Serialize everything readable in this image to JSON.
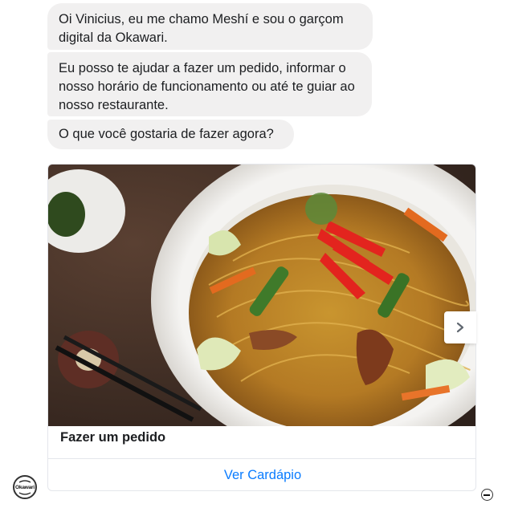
{
  "messages": [
    {
      "text": "Oi Vinicius, eu me chamo Meshí e sou o garçom digital da Okawari."
    },
    {
      "text": "Eu posso te ajudar a fazer um pedido, informar o nosso horário de funcionamento ou até te guiar ao nosso restaurante."
    },
    {
      "text": "O que você gostaria de fazer agora?"
    }
  ],
  "card": {
    "title": "Fazer um pedido",
    "button_label": "Ver Cardápio",
    "image_icon": "yakisoba-noodles-photo"
  },
  "carousel": {
    "next_icon": "chevron-right-icon"
  },
  "bot": {
    "avatar_text": "Okawari",
    "avatar_icon": "okawari-logo-icon"
  },
  "colors": {
    "bubble_bg": "#f1f0f0",
    "link_blue": "#0a7cff",
    "text": "#1c1e21"
  }
}
